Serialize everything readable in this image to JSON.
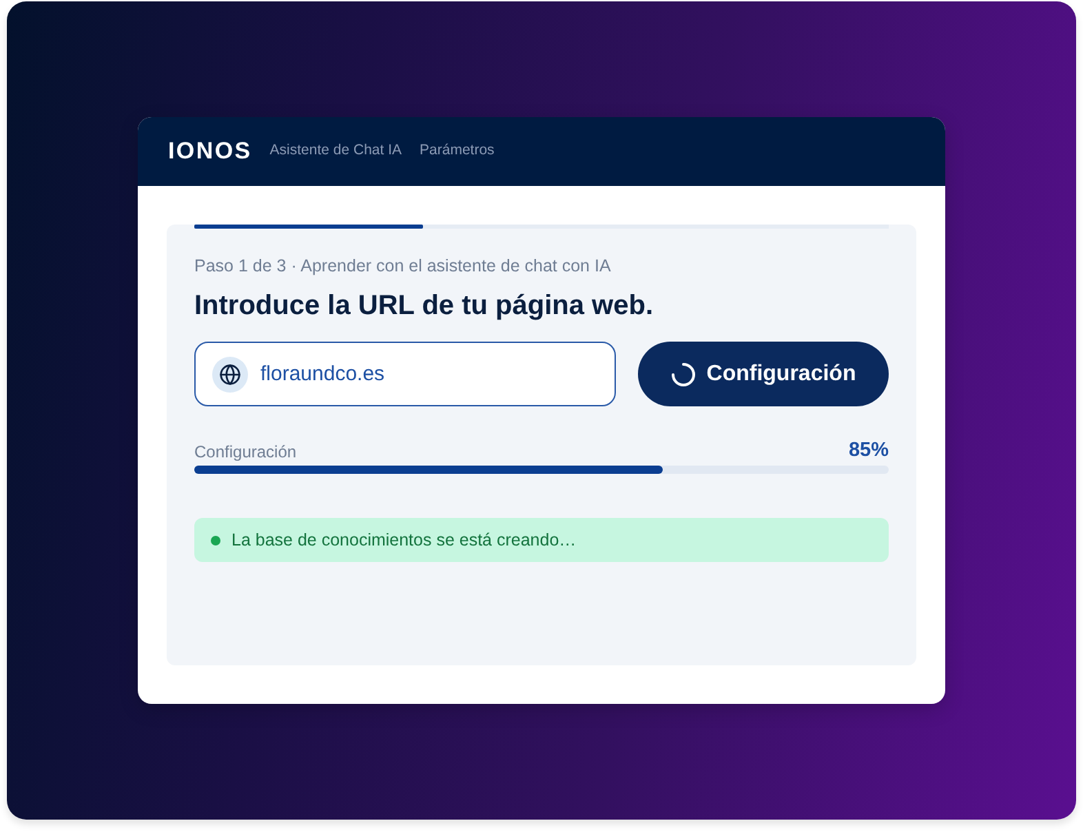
{
  "header": {
    "logo": "IONOS",
    "nav": [
      {
        "label": "Asistente de Chat IA",
        "selected": false
      },
      {
        "label": "Parámetros",
        "selected": false
      }
    ]
  },
  "wizard": {
    "step_indicator": {
      "level": 0.33
    },
    "step_label": "Paso 1 de 3 · Aprender con el asistente de chat con IA",
    "title": "Introduce la URL de tu página web.",
    "url_field": {
      "value": "floraundco.es"
    },
    "button": {
      "label": "Configuración",
      "loading": true
    }
  },
  "progress": {
    "label": "Configuración",
    "reading": "85%",
    "level": 0.675
  },
  "status": {
    "kind": "success",
    "text": "La base de conocimientos se está creando…"
  }
}
